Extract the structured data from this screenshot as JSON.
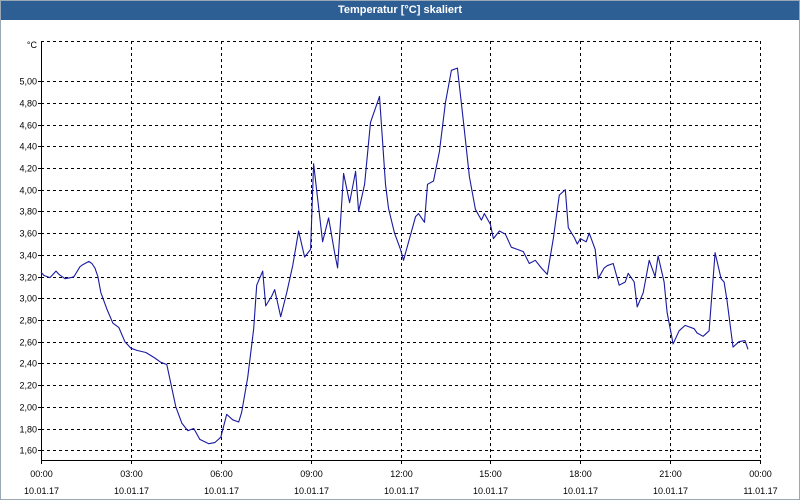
{
  "window": {
    "title": "Temperatur [°C] skaliert"
  },
  "colors": {
    "titlebar": "#2d5f95",
    "line": "#1a1aa0",
    "grid": "#000000",
    "axis": "#000000",
    "background": "#ffffff"
  },
  "chart_data": {
    "type": "line",
    "title": "Temperatur [°C] skaliert",
    "ylabel": "°C",
    "xlabel": "",
    "ylim": [
      1.51,
      5.37
    ],
    "xlim": [
      "10.01.17 00:00",
      "11.01.17 00:00"
    ],
    "grid": true,
    "yticks": [
      "1,60",
      "1,80",
      "2,00",
      "2,20",
      "2,40",
      "2,60",
      "2,80",
      "3,00",
      "3,20",
      "3,40",
      "3,60",
      "3,80",
      "4,00",
      "4,20",
      "4,40",
      "4,60",
      "4,80",
      "5,00"
    ],
    "ytick_values": [
      1.6,
      1.8,
      2.0,
      2.2,
      2.4,
      2.6,
      2.8,
      3.0,
      3.2,
      3.4,
      3.6,
      3.8,
      4.0,
      4.2,
      4.4,
      4.6,
      4.8,
      5.0
    ],
    "xticks": [
      {
        "time": "00:00",
        "date": "10.01.17",
        "hour": 0
      },
      {
        "time": "03:00",
        "date": "10.01.17",
        "hour": 3
      },
      {
        "time": "06:00",
        "date": "10.01.17",
        "hour": 6
      },
      {
        "time": "09:00",
        "date": "10.01.17",
        "hour": 9
      },
      {
        "time": "12:00",
        "date": "10.01.17",
        "hour": 12
      },
      {
        "time": "15:00",
        "date": "10.01.17",
        "hour": 15
      },
      {
        "time": "18:00",
        "date": "10.01.17",
        "hour": 18
      },
      {
        "time": "21:00",
        "date": "10.01.17",
        "hour": 21
      },
      {
        "time": "00:00",
        "date": "11.01.17",
        "hour": 24
      }
    ],
    "series": [
      {
        "x_hours": [
          0,
          0.1,
          0.3,
          0.5,
          0.6,
          0.8,
          1.0,
          1.1,
          1.3,
          1.4,
          1.6,
          1.7,
          1.8,
          1.9,
          2.0,
          2.2,
          2.4,
          2.6,
          2.8,
          3.0,
          3.2,
          3.5,
          3.8,
          4.0,
          4.2,
          4.5,
          4.7,
          4.9,
          5.1,
          5.3,
          5.6,
          5.8,
          6.0,
          6.2,
          6.4,
          6.6,
          6.7,
          6.9,
          7.1,
          7.2,
          7.4,
          7.5,
          7.7,
          7.8,
          8.0,
          8.2,
          8.4,
          8.6,
          8.8,
          9.0,
          9.1,
          9.2,
          9.4,
          9.6,
          9.8,
          9.9,
          10.1,
          10.3,
          10.5,
          10.6,
          10.8,
          10.9,
          11.0,
          11.3,
          11.5,
          11.6,
          11.8,
          12.0,
          12.1,
          12.3,
          12.5,
          12.6,
          12.8,
          12.9,
          13.1,
          13.3,
          13.5,
          13.7,
          13.9,
          14.1,
          14.3,
          14.5,
          14.7,
          14.8,
          15.0,
          15.1,
          15.3,
          15.5,
          15.7,
          15.9,
          16.1,
          16.3,
          16.5,
          16.7,
          16.9,
          17.1,
          17.3,
          17.5,
          17.6,
          17.8,
          17.9,
          18.0,
          18.2,
          18.3,
          18.5,
          18.6,
          18.8,
          18.9,
          19.1,
          19.3,
          19.5,
          19.6,
          19.8,
          19.9,
          20.1,
          20.3,
          20.5,
          20.6,
          20.8,
          20.9,
          21.1,
          21.3,
          21.5,
          21.6,
          21.8,
          21.9,
          22.1,
          22.3,
          22.5,
          22.7,
          22.8,
          22.9,
          23.1,
          23.3,
          23.5,
          23.6,
          23.8,
          24.0
        ],
        "values": [
          3.24,
          3.21,
          3.19,
          3.25,
          3.22,
          3.18,
          3.19,
          3.2,
          3.29,
          3.31,
          3.34,
          3.32,
          3.28,
          3.2,
          3.05,
          2.9,
          2.77,
          2.73,
          2.6,
          2.54,
          2.52,
          2.5,
          2.45,
          2.41,
          2.39,
          2.0,
          1.85,
          1.78,
          1.8,
          1.7,
          1.66,
          1.67,
          1.72,
          1.93,
          1.88,
          1.86,
          1.95,
          2.27,
          2.72,
          3.12,
          3.25,
          2.93,
          3.02,
          3.08,
          2.83,
          3.05,
          3.3,
          3.62,
          3.38,
          3.45,
          4.24,
          4.0,
          3.52,
          3.74,
          3.42,
          3.28,
          4.15,
          3.88,
          4.17,
          3.8,
          4.05,
          4.33,
          4.62,
          4.86,
          4.05,
          3.83,
          3.6,
          3.45,
          3.35,
          3.55,
          3.75,
          3.78,
          3.7,
          4.05,
          4.08,
          4.35,
          4.8,
          5.1,
          5.12,
          4.63,
          4.12,
          3.82,
          3.72,
          3.78,
          3.68,
          3.55,
          3.62,
          3.59,
          3.47,
          3.45,
          3.43,
          3.32,
          3.35,
          3.28,
          3.22,
          3.55,
          3.95,
          4.0,
          3.65,
          3.56,
          3.5,
          3.55,
          3.52,
          3.6,
          3.45,
          3.18,
          3.28,
          3.3,
          3.32,
          3.12,
          3.15,
          3.23,
          3.15,
          2.92,
          3.05,
          3.35,
          3.2,
          3.39,
          3.15,
          2.87,
          2.58,
          2.7,
          2.75,
          2.74,
          2.72,
          2.68,
          2.65,
          2.7,
          3.42,
          3.18,
          3.15,
          2.98,
          2.55,
          2.6,
          2.61,
          2.53
        ]
      }
    ]
  }
}
